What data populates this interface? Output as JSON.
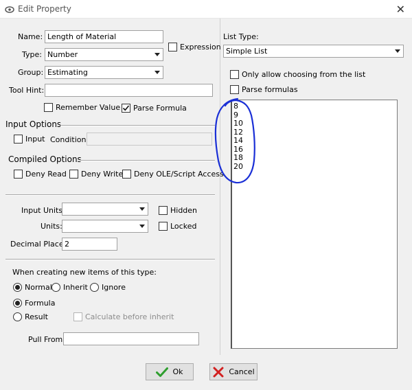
{
  "window": {
    "title": "Edit Property",
    "close_glyph": "✕"
  },
  "fields": {
    "name_label": "Name:",
    "name_value": "Length of Material",
    "expression_label": "Expression",
    "type_label": "Type:",
    "type_value": "Number",
    "group_label": "Group:",
    "group_value": "Estimating",
    "tool_hint_label": "Tool Hint:",
    "tool_hint_value": "",
    "remember_value_label": "Remember Value",
    "parse_formula_label": "Parse Formula"
  },
  "input_options": {
    "title": "Input Options",
    "input_label": "Input",
    "condition_label": "Condition:",
    "condition_value": ""
  },
  "compiled_options": {
    "title": "Compiled Options",
    "deny_read": "Deny Read",
    "deny_write": "Deny Write",
    "deny_ole": "Deny OLE/Script Access"
  },
  "units": {
    "input_units_label": "Input Units:",
    "input_units_value": "",
    "hidden_label": "Hidden",
    "units_label": "Units:",
    "units_value": "",
    "locked_label": "Locked",
    "decimal_places_label": "Decimal Places:",
    "decimal_places_value": "2"
  },
  "creation": {
    "heading": "When creating new items of this type:",
    "normal": "Normal",
    "inherit": "Inherit",
    "ignore": "Ignore",
    "formula": "Formula",
    "result": "Result",
    "calc_before_inherit": "Calculate before inherit",
    "pull_from_label": "Pull From:",
    "pull_from_value": ""
  },
  "list_panel": {
    "list_type_label": "List Type:",
    "list_type_value": "Simple List",
    "only_allow_label": "Only allow choosing from the list",
    "parse_formulas_label": "Parse formulas",
    "items": [
      "8",
      "9",
      "10",
      "12",
      "14",
      "16",
      "18",
      "20"
    ]
  },
  "buttons": {
    "ok": "Ok",
    "cancel": "Cancel"
  },
  "colors": {
    "annotation": "#1a2fd6",
    "ok_check": "#2e9e2e",
    "cancel_x": "#d22020"
  },
  "state": {
    "expression": false,
    "remember_value": false,
    "parse_formula": true,
    "input": false,
    "deny_read": false,
    "deny_write": false,
    "deny_ole": false,
    "hidden": false,
    "locked": false,
    "create_mode": "Normal",
    "value_mode": "Formula",
    "calc_before_inherit": false,
    "only_allow": false,
    "parse_formulas": false
  }
}
